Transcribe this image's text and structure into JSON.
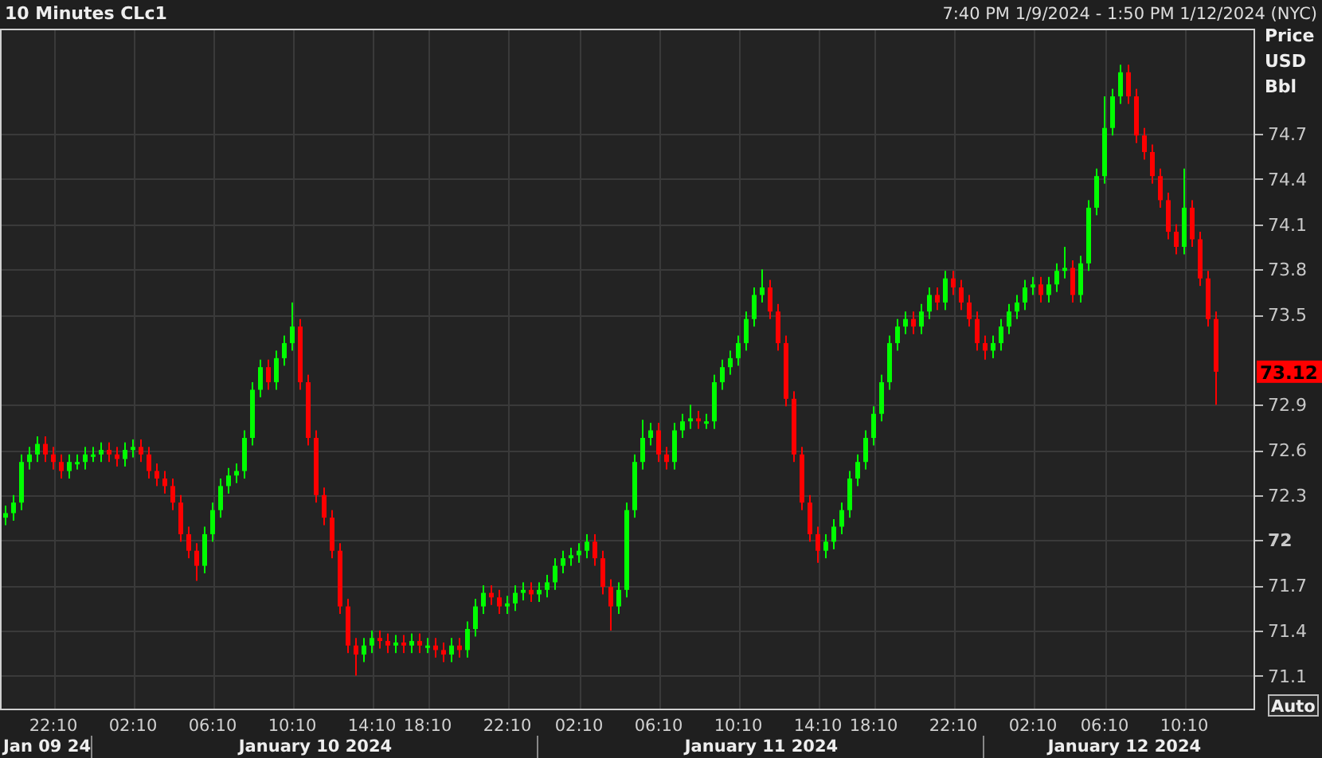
{
  "header": {
    "title": "10 Minutes CLc1",
    "range": "7:40 PM 1/9/2024 - 1:50 PM 1/12/2024 (NYC)"
  },
  "chart": {
    "axis_unit": [
      "Price",
      "USD",
      "Bbl"
    ],
    "last_price": "73.12",
    "auto_button": "Auto",
    "date_labels": [
      "Jan 09 24",
      "January 10 2024",
      "January 11 2024",
      "January 12 2024"
    ],
    "chart_data": {
      "type": "candlestick",
      "grid": true,
      "ylim": [
        70.87,
        75.4
      ],
      "yticks": [
        74.7,
        74.4,
        74.1,
        73.8,
        73.5,
        72.9,
        72.6,
        72.3,
        72,
        71.7,
        71.4,
        71.1
      ],
      "categories": [
        null,
        null,
        null,
        null,
        null,
        null,
        "22:10",
        null,
        null,
        null,
        null,
        null,
        null,
        null,
        null,
        null,
        "02:10",
        null,
        null,
        null,
        null,
        null,
        null,
        null,
        null,
        null,
        "06:10",
        null,
        null,
        null,
        null,
        null,
        null,
        null,
        null,
        null,
        "10:10",
        null,
        null,
        null,
        null,
        null,
        null,
        null,
        null,
        null,
        "14:10",
        null,
        null,
        null,
        null,
        null,
        null,
        "18:10",
        null,
        null,
        null,
        null,
        null,
        null,
        null,
        null,
        null,
        "22:10",
        null,
        null,
        null,
        null,
        null,
        null,
        null,
        null,
        "02:10",
        null,
        null,
        null,
        null,
        null,
        null,
        null,
        null,
        null,
        "06:10",
        null,
        null,
        null,
        null,
        null,
        null,
        null,
        null,
        null,
        "10:10",
        null,
        null,
        null,
        null,
        null,
        null,
        null,
        null,
        null,
        "14:10",
        null,
        null,
        null,
        null,
        null,
        null,
        "18:10",
        null,
        null,
        null,
        null,
        null,
        null,
        null,
        null,
        null,
        "22:10",
        null,
        null,
        null,
        null,
        null,
        null,
        null,
        null,
        null,
        "02:10",
        null,
        null,
        null,
        null,
        null,
        null,
        null,
        null,
        "06:10",
        null,
        null,
        null,
        null,
        null,
        null,
        null,
        null,
        null,
        "10:10",
        null,
        null,
        null,
        null
      ],
      "ohlc": [
        [
          72.15,
          72.23,
          72.1,
          72.18
        ],
        [
          72.18,
          72.3,
          72.13,
          72.25
        ],
        [
          72.25,
          72.57,
          72.2,
          72.52
        ],
        [
          72.52,
          72.62,
          72.47,
          72.57
        ],
        [
          72.57,
          72.69,
          72.52,
          72.64
        ],
        [
          72.64,
          72.69,
          72.52,
          72.57
        ],
        [
          72.57,
          72.62,
          72.47,
          72.52
        ],
        [
          72.52,
          72.57,
          72.41,
          72.46
        ],
        [
          72.46,
          72.57,
          72.41,
          72.52
        ],
        [
          72.52,
          72.57,
          72.47,
          72.52
        ],
        [
          72.52,
          72.62,
          72.47,
          72.57
        ],
        [
          72.57,
          72.62,
          72.52,
          72.57
        ],
        [
          72.57,
          72.65,
          72.52,
          72.6
        ],
        [
          72.6,
          72.65,
          72.52,
          72.57
        ],
        [
          72.57,
          72.62,
          72.49,
          72.54
        ],
        [
          72.54,
          72.65,
          72.49,
          72.6
        ],
        [
          72.6,
          72.67,
          72.55,
          72.62
        ],
        [
          72.62,
          72.67,
          72.52,
          72.57
        ],
        [
          72.57,
          72.62,
          72.41,
          72.46
        ],
        [
          72.46,
          72.51,
          72.36,
          72.41
        ],
        [
          72.41,
          72.46,
          72.31,
          72.36
        ],
        [
          72.36,
          72.41,
          72.2,
          72.25
        ],
        [
          72.25,
          72.3,
          71.99,
          72.04
        ],
        [
          72.04,
          72.09,
          71.88,
          71.93
        ],
        [
          71.93,
          71.98,
          71.73,
          71.83
        ],
        [
          71.83,
          72.09,
          71.78,
          72.04
        ],
        [
          72.04,
          72.25,
          71.99,
          72.2
        ],
        [
          72.2,
          72.41,
          72.15,
          72.36
        ],
        [
          72.36,
          72.48,
          72.31,
          72.43
        ],
        [
          72.43,
          72.51,
          72.38,
          72.46
        ],
        [
          72.46,
          72.73,
          72.41,
          72.68
        ],
        [
          72.68,
          73.05,
          72.63,
          73.0
        ],
        [
          73.0,
          73.2,
          72.95,
          73.15
        ],
        [
          73.15,
          73.2,
          73.0,
          73.05
        ],
        [
          73.05,
          73.26,
          73.0,
          73.21
        ],
        [
          73.21,
          73.36,
          73.16,
          73.31
        ],
        [
          73.31,
          73.58,
          73.26,
          73.42
        ],
        [
          73.42,
          73.47,
          73.0,
          73.05
        ],
        [
          73.05,
          73.1,
          72.63,
          72.68
        ],
        [
          72.68,
          72.73,
          72.25,
          72.3
        ],
        [
          72.3,
          72.35,
          72.1,
          72.15
        ],
        [
          72.15,
          72.2,
          71.88,
          71.93
        ],
        [
          71.93,
          71.98,
          71.51,
          71.56
        ],
        [
          71.56,
          71.61,
          71.25,
          71.3
        ],
        [
          71.3,
          71.35,
          71.1,
          71.24
        ],
        [
          71.24,
          71.35,
          71.19,
          71.3
        ],
        [
          71.3,
          71.4,
          71.25,
          71.35
        ],
        [
          71.35,
          71.4,
          71.28,
          71.33
        ],
        [
          71.33,
          71.38,
          71.25,
          71.3
        ],
        [
          71.3,
          71.37,
          71.25,
          71.32
        ],
        [
          71.32,
          71.37,
          71.25,
          71.3
        ],
        [
          71.3,
          71.38,
          71.25,
          71.33
        ],
        [
          71.33,
          71.38,
          71.25,
          71.3
        ],
        [
          71.3,
          71.35,
          71.25,
          71.3
        ],
        [
          71.3,
          71.35,
          71.22,
          71.27
        ],
        [
          71.27,
          71.32,
          71.19,
          71.24
        ],
        [
          71.24,
          71.35,
          71.19,
          71.3
        ],
        [
          71.3,
          71.35,
          71.22,
          71.27
        ],
        [
          71.27,
          71.46,
          71.22,
          71.41
        ],
        [
          71.41,
          71.61,
          71.36,
          71.56
        ],
        [
          71.56,
          71.7,
          71.51,
          71.65
        ],
        [
          71.65,
          71.7,
          71.57,
          71.62
        ],
        [
          71.62,
          71.67,
          71.51,
          71.56
        ],
        [
          71.56,
          71.63,
          71.51,
          71.58
        ],
        [
          71.58,
          71.7,
          71.53,
          71.65
        ],
        [
          71.65,
          71.72,
          71.6,
          71.67
        ],
        [
          71.67,
          71.72,
          71.59,
          71.64
        ],
        [
          71.64,
          71.72,
          71.59,
          71.67
        ],
        [
          71.67,
          71.77,
          71.62,
          71.72
        ],
        [
          71.72,
          71.88,
          71.67,
          71.83
        ],
        [
          71.83,
          71.93,
          71.78,
          71.88
        ],
        [
          71.88,
          71.95,
          71.83,
          71.9
        ],
        [
          71.9,
          71.98,
          71.85,
          71.93
        ],
        [
          71.93,
          72.04,
          71.88,
          71.99
        ],
        [
          71.99,
          72.04,
          71.83,
          71.88
        ],
        [
          71.88,
          71.93,
          71.64,
          71.69
        ],
        [
          71.69,
          71.74,
          71.4,
          71.56
        ],
        [
          71.56,
          71.72,
          71.51,
          71.67
        ],
        [
          71.67,
          72.25,
          71.62,
          72.2
        ],
        [
          72.2,
          72.57,
          72.15,
          72.52
        ],
        [
          72.52,
          72.8,
          72.47,
          72.68
        ],
        [
          72.68,
          72.78,
          72.63,
          72.73
        ],
        [
          72.73,
          72.78,
          72.52,
          72.57
        ],
        [
          72.57,
          72.62,
          72.47,
          72.52
        ],
        [
          72.52,
          72.78,
          72.47,
          72.73
        ],
        [
          72.73,
          72.84,
          72.68,
          72.79
        ],
        [
          72.79,
          72.9,
          72.74,
          72.81
        ],
        [
          72.81,
          72.86,
          72.74,
          72.79
        ],
        [
          72.79,
          72.84,
          72.74,
          72.79
        ],
        [
          72.79,
          73.1,
          72.74,
          73.05
        ],
        [
          73.05,
          73.2,
          73.0,
          73.15
        ],
        [
          73.15,
          73.26,
          73.1,
          73.21
        ],
        [
          73.21,
          73.36,
          73.16,
          73.31
        ],
        [
          73.31,
          73.52,
          73.26,
          73.47
        ],
        [
          73.47,
          73.68,
          73.42,
          73.63
        ],
        [
          73.63,
          73.8,
          73.58,
          73.68
        ],
        [
          73.68,
          73.73,
          73.47,
          73.52
        ],
        [
          73.52,
          73.57,
          73.26,
          73.31
        ],
        [
          73.31,
          73.36,
          72.89,
          72.94
        ],
        [
          72.94,
          72.99,
          72.52,
          72.57
        ],
        [
          72.57,
          72.62,
          72.2,
          72.25
        ],
        [
          72.25,
          72.3,
          71.99,
          72.04
        ],
        [
          72.04,
          72.09,
          71.85,
          71.93
        ],
        [
          71.93,
          72.04,
          71.88,
          71.99
        ],
        [
          71.99,
          72.14,
          71.94,
          72.09
        ],
        [
          72.09,
          72.25,
          72.04,
          72.2
        ],
        [
          72.2,
          72.46,
          72.15,
          72.41
        ],
        [
          72.41,
          72.57,
          72.36,
          72.52
        ],
        [
          72.52,
          72.73,
          72.47,
          72.68
        ],
        [
          72.68,
          72.89,
          72.63,
          72.84
        ],
        [
          72.84,
          73.1,
          72.79,
          73.05
        ],
        [
          73.05,
          73.36,
          73.0,
          73.31
        ],
        [
          73.31,
          73.47,
          73.26,
          73.42
        ],
        [
          73.42,
          73.52,
          73.37,
          73.47
        ],
        [
          73.47,
          73.52,
          73.37,
          73.42
        ],
        [
          73.42,
          73.57,
          73.37,
          73.52
        ],
        [
          73.52,
          73.68,
          73.47,
          73.63
        ],
        [
          73.63,
          73.68,
          73.53,
          73.58
        ],
        [
          73.58,
          73.79,
          73.53,
          73.74
        ],
        [
          73.74,
          73.79,
          73.63,
          73.68
        ],
        [
          73.68,
          73.73,
          73.53,
          73.58
        ],
        [
          73.58,
          73.63,
          73.42,
          73.47
        ],
        [
          73.47,
          73.52,
          73.26,
          73.31
        ],
        [
          73.31,
          73.36,
          73.2,
          73.26
        ],
        [
          73.26,
          73.36,
          73.21,
          73.31
        ],
        [
          73.31,
          73.47,
          73.26,
          73.42
        ],
        [
          73.42,
          73.57,
          73.37,
          73.52
        ],
        [
          73.52,
          73.63,
          73.47,
          73.58
        ],
        [
          73.58,
          73.73,
          73.53,
          73.68
        ],
        [
          73.68,
          73.75,
          73.63,
          73.7
        ],
        [
          73.7,
          73.75,
          73.58,
          73.63
        ],
        [
          73.63,
          73.75,
          73.58,
          73.7
        ],
        [
          73.7,
          73.84,
          73.65,
          73.79
        ],
        [
          73.79,
          73.95,
          73.74,
          73.81
        ],
        [
          73.81,
          73.86,
          73.58,
          73.63
        ],
        [
          73.63,
          73.89,
          73.58,
          73.84
        ],
        [
          73.84,
          74.26,
          73.79,
          74.21
        ],
        [
          74.21,
          74.47,
          74.16,
          74.42
        ],
        [
          74.42,
          74.95,
          74.37,
          74.74
        ],
        [
          74.74,
          75.0,
          74.69,
          74.95
        ],
        [
          74.95,
          75.16,
          74.9,
          75.11
        ],
        [
          75.11,
          75.16,
          74.9,
          74.95
        ],
        [
          74.95,
          75.0,
          74.64,
          74.69
        ],
        [
          74.69,
          74.74,
          74.53,
          74.58
        ],
        [
          74.58,
          74.63,
          74.37,
          74.42
        ],
        [
          74.42,
          74.47,
          74.21,
          74.26
        ],
        [
          74.26,
          74.31,
          74.0,
          74.05
        ],
        [
          74.05,
          74.1,
          73.9,
          73.95
        ],
        [
          73.95,
          74.47,
          73.9,
          74.21
        ],
        [
          74.21,
          74.26,
          73.95,
          74.0
        ],
        [
          74.0,
          74.05,
          73.69,
          73.74
        ],
        [
          73.74,
          73.79,
          73.42,
          73.47
        ],
        [
          73.47,
          73.52,
          72.9,
          73.12
        ]
      ]
    }
  }
}
